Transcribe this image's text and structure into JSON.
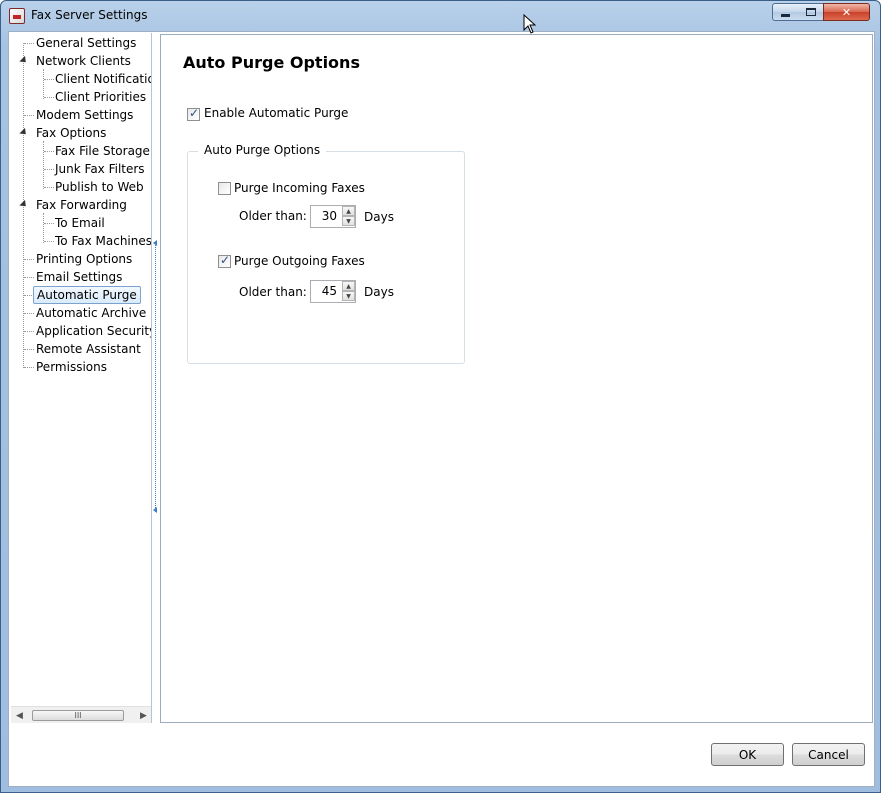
{
  "window": {
    "title": "Fax Server Settings",
    "minimize_label": "—",
    "maximize_label": "",
    "close_label": "✕"
  },
  "tree": {
    "items": [
      {
        "label": "General Settings",
        "level": 0,
        "expander": false
      },
      {
        "label": "Network Clients",
        "level": 0,
        "expander": true
      },
      {
        "label": "Client Notification",
        "level": 1,
        "expander": false
      },
      {
        "label": "Client Priorities",
        "level": 1,
        "expander": false
      },
      {
        "label": "Modem Settings",
        "level": 0,
        "expander": false
      },
      {
        "label": "Fax Options",
        "level": 0,
        "expander": true
      },
      {
        "label": "Fax File Storage",
        "level": 1,
        "expander": false
      },
      {
        "label": "Junk Fax Filters",
        "level": 1,
        "expander": false
      },
      {
        "label": "Publish to Web",
        "level": 1,
        "expander": false
      },
      {
        "label": "Fax Forwarding",
        "level": 0,
        "expander": true
      },
      {
        "label": "To Email",
        "level": 1,
        "expander": false
      },
      {
        "label": "To Fax Machines",
        "level": 1,
        "expander": false
      },
      {
        "label": "Printing Options",
        "level": 0,
        "expander": false
      },
      {
        "label": "Email Settings",
        "level": 0,
        "expander": false
      },
      {
        "label": "Automatic Purge",
        "level": 0,
        "expander": false,
        "selected": true
      },
      {
        "label": "Automatic Archive",
        "level": 0,
        "expander": false
      },
      {
        "label": "Application Security",
        "level": 0,
        "expander": false
      },
      {
        "label": "Remote Assistant",
        "level": 0,
        "expander": false
      },
      {
        "label": "Permissions",
        "level": 0,
        "expander": false
      }
    ],
    "scroll_left": "◀",
    "scroll_right": "▶",
    "scroll_thumb": "III"
  },
  "content": {
    "title": "Auto Purge Options",
    "enable_label": "Enable Automatic Purge",
    "enable_checked": true,
    "group_title": "Auto Purge Options",
    "incoming": {
      "label": "Purge Incoming Faxes",
      "checked": false,
      "older_than_label": "Older than:",
      "value": "30",
      "unit": "Days"
    },
    "outgoing": {
      "label": "Purge Outgoing Faxes",
      "checked": true,
      "older_than_label": "Older than:",
      "value": "45",
      "unit": "Days"
    },
    "spin_up": "▲",
    "spin_down": "▼"
  },
  "buttons": {
    "ok": "OK",
    "cancel": "Cancel"
  }
}
